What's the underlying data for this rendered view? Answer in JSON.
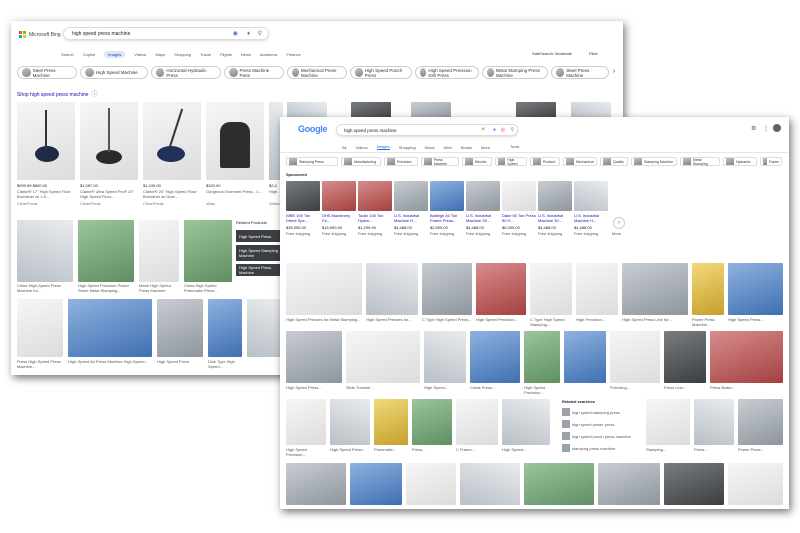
{
  "bing": {
    "logo": "Microsoft Bing",
    "query": "high speed press machine",
    "tabs": [
      "Search",
      "Copilot",
      "Images",
      "Videos",
      "Maps",
      "Shopping",
      "Travel",
      "Flights",
      "News",
      "Academic",
      "Finance"
    ],
    "active_tab": "Images",
    "safesearch": "SafeSearch: Moderate",
    "filter": "Filter",
    "pills": [
      "Steel Press Machine",
      "High Speed Machine",
      "Horizontal Hydraulic Press",
      "Press Machine Parts",
      "Mechanical Press Machine",
      "High Speed Punch Press",
      "High Speed Precision Drill Press",
      "Metal Stamping Press Machine",
      "Steel Press Machine"
    ],
    "shop_heading": "Shop high speed press machine",
    "products": [
      {
        "price": "$999.99 $600.00",
        "title": "Clarke® 17\" High Speed Floor Burnisher w/ 1.5...",
        "seller": "CleanFreak"
      },
      {
        "price": "$1,087.00",
        "title": "Clarke® Ultra Speed Pro® 20\" High Speed Floor...",
        "seller": "CleanFreak"
      },
      {
        "price": "$1,249.00",
        "title": "Clarke® 20\" High Speed Floor Burnisher w/ Dust...",
        "seller": "CleanFreak"
      },
      {
        "price": "$320.00",
        "title": "Gorgeous Grommet Press - 1...",
        "seller": "eBay"
      },
      {
        "price": "$2,4",
        "title": "High...",
        "seller": "Walmart"
      }
    ],
    "related_heading": "Related Products",
    "related": [
      "High Speed Press",
      "High Speed Stamping Machine",
      "High Speed Press Machine"
    ],
    "row2_captions": [
      "China High-Speed Press Machine for...",
      "High Speed Precision Power Sheet Metal Stamping...",
      "Metal High Speed Press Machine",
      "China High Speed Pneumatic Press...",
      "Precision High Speed...",
      "High Speed Press Machine..."
    ],
    "row3_captions": [
      "Press High Speed Press Machine...",
      "High-Speed Air Press Machine High Speed...",
      "High Speed Press",
      "Disk Type High Speed..."
    ]
  },
  "google": {
    "logo": "Google",
    "query": "high speed press machine",
    "tabs": [
      "All",
      "Videos",
      "Images",
      "Shopping",
      "News",
      "Web",
      "Books",
      "More",
      "Tools"
    ],
    "active_tab": "Images",
    "chips": [
      "Stamping Press",
      "Manufacturing",
      "Precision",
      "Press Machine",
      "Electric",
      "High Speed",
      "Product",
      "Mechanical",
      "Quality",
      "Stamping Machine",
      "Metal Stamping",
      "Hydraulic",
      "Frame"
    ],
    "sponsored": "Sponsored",
    "sponsored_items": [
      {
        "title": "WBE 100 Ton Direct Spe...",
        "price": "$35,955.00",
        "store": "Free shipping"
      },
      {
        "title": "DHS Machinery Fa...",
        "price": "$16,990.00",
        "store": "Free shipping"
      },
      {
        "title": "Tooliz 100 Ton Hydra...",
        "price": "$1,299.99",
        "store": "Free shipping"
      },
      {
        "title": "U.S. Industrial Machine H...",
        "price": "$4,488.00",
        "store": "Free shipping"
      },
      {
        "title": "Baileigh 40 Ton Frame Press...",
        "price": "$2,599.00",
        "store": "Free shipping"
      },
      {
        "title": "U.S. Industrial Machine 25...",
        "price": "$4,488.00",
        "store": "Free shipping"
      },
      {
        "title": "Dake 50 Ton Press 50 H...",
        "price": "$6,399.00",
        "store": "Free shipping"
      },
      {
        "title": "U.S. Industrial Machine 30...",
        "price": "$4,488.00",
        "store": "Free shipping"
      },
      {
        "title": "U.S. Industrial Machine H...",
        "price": "$4,488.00",
        "store": "Free shipping"
      }
    ],
    "more_label": "More",
    "row1_captions": [
      "High Speed Presses for Metal Stamping...",
      "High Speed Presses for...",
      "C Type High Speed Press...",
      "High Speed Precision...",
      "C Type High Speed Stamping...",
      "High Precision...",
      "High Speed Press Line for...",
      "Power Press Machine...",
      "High Speed Press..."
    ],
    "row2_captions": [
      "High Speed Press...",
      "Slide Transfer...",
      "High Speed...",
      "Crank Press...",
      "High Speed Precision...",
      "Punching...",
      "Press Line...",
      "Press Brake..."
    ],
    "related_heading": "Related searches",
    "related": [
      "high speed stamping press",
      "high speed power press",
      "high speed punch press machine",
      "stamping press machine"
    ],
    "row3_captions": [
      "High Speed Precision...",
      "High Speed Press...",
      "Pneumatic...",
      "Press...",
      "C Frame...",
      "High Speed...",
      "Stamping...",
      "Press...",
      "Power Press..."
    ]
  }
}
